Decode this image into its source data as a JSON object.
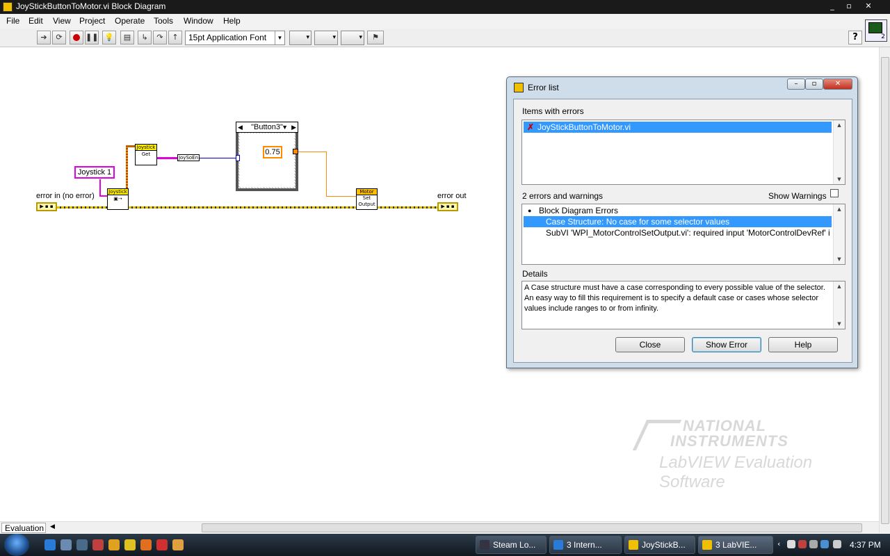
{
  "window": {
    "title": "JoyStickButtonToMotor.vi Block Diagram",
    "controls": [
      "_",
      "▫",
      "✕"
    ]
  },
  "menubar": {
    "items": [
      "File",
      "Edit",
      "View",
      "Project",
      "Operate",
      "Tools",
      "Window",
      "Help"
    ]
  },
  "toolbar": {
    "font": "15pt Application Font",
    "help": "?",
    "icon_number": "2"
  },
  "diagram": {
    "labels": {
      "error_in": "error in (no error)",
      "error_out": "error out"
    },
    "joystick_constant": "Joystick 1",
    "joystick_open": {
      "header": "Joystick"
    },
    "joystick_get": {
      "header": "Joystick",
      "body": "Get"
    },
    "unbundle": "JoySoEn",
    "case_selector": "\"Button3\"",
    "numeric_constant": "0.75",
    "motor_node": {
      "header": "Motor",
      "body_line1": "Set",
      "body_line2": "Output"
    },
    "cluster_terminal_text": "▶ ▪ ▪"
  },
  "watermark": {
    "line1": "NATIONAL",
    "line2": "INSTRUMENTS",
    "line3": "LabVIEW Evaluation Software"
  },
  "error_dialog": {
    "title": "Error list",
    "items_label": "Items with errors",
    "items": [
      "JoyStickButtonToMotor.vi"
    ],
    "count_label": "2 errors and warnings",
    "show_warnings_label": "Show Warnings",
    "errors_header": "Block Diagram Errors",
    "errors": [
      "Case Structure: No case for some selector values",
      "SubVI 'WPI_MotorControlSetOutput.vi': required input 'MotorControlDevRef' i"
    ],
    "details_label": "Details",
    "details_text": "A Case structure must have a case corresponding to every possible value of the selector.  An easy way to fill this requirement is to specify a default case or cases whose selector values include ranges to or from infinity.",
    "buttons": {
      "close": "Close",
      "show_error": "Show Error",
      "help": "Help"
    }
  },
  "statusbar": {
    "context": "Evaluation"
  },
  "taskbar": {
    "tasks": [
      "Steam Lo...",
      "3 Intern...",
      "JoyStickB...",
      "3 LabVIE..."
    ],
    "clock": "4:37 PM"
  },
  "colors": {
    "error_wire": "#e2c000",
    "refnum_wire": "#e000e0",
    "numeric_wire": "#ff8a00",
    "selection": "#3399ff"
  }
}
